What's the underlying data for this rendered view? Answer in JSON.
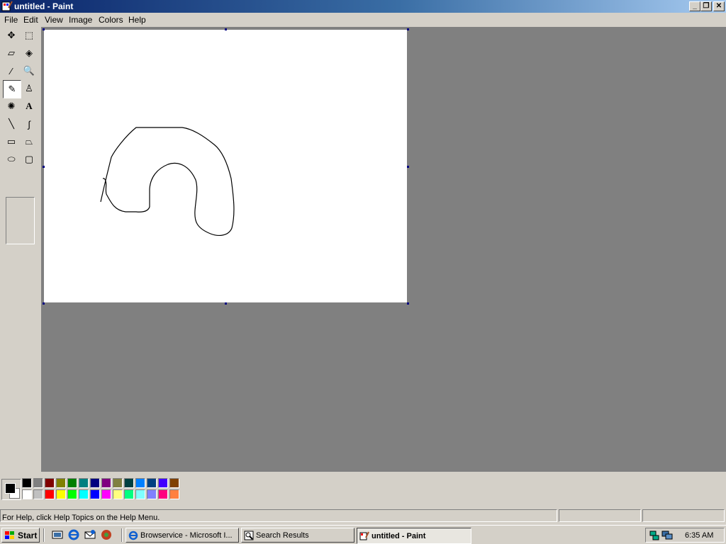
{
  "window": {
    "title": "untitled - Paint"
  },
  "menu": {
    "items": [
      "File",
      "Edit",
      "View",
      "Image",
      "Colors",
      "Help"
    ]
  },
  "tools": {
    "items": [
      {
        "name": "free-form-select",
        "glyph": "✥"
      },
      {
        "name": "select",
        "glyph": "⬚"
      },
      {
        "name": "eraser",
        "glyph": "▱"
      },
      {
        "name": "fill-with-color",
        "glyph": "◈"
      },
      {
        "name": "pick-color",
        "glyph": "⁄"
      },
      {
        "name": "magnifier",
        "glyph": "🔍"
      },
      {
        "name": "pencil",
        "glyph": "✎"
      },
      {
        "name": "brush",
        "glyph": "♙"
      },
      {
        "name": "airbrush",
        "glyph": "✺"
      },
      {
        "name": "text",
        "glyph": "A"
      },
      {
        "name": "line",
        "glyph": "╲"
      },
      {
        "name": "curve",
        "glyph": "∫"
      },
      {
        "name": "rectangle",
        "glyph": "▭"
      },
      {
        "name": "polygon",
        "glyph": "⏢"
      },
      {
        "name": "ellipse",
        "glyph": "⬭"
      },
      {
        "name": "rounded-rectangle",
        "glyph": "▢"
      }
    ],
    "selected": "pencil"
  },
  "palette": {
    "foreground": "#000000",
    "background": "#ffffff",
    "top_row": [
      "#000000",
      "#808080",
      "#800000",
      "#808000",
      "#008000",
      "#008080",
      "#000080",
      "#800080",
      "#808040",
      "#004040",
      "#0080ff",
      "#004080",
      "#4000ff",
      "#804000"
    ],
    "bottom_row": [
      "#ffffff",
      "#c0c0c0",
      "#ff0000",
      "#ffff00",
      "#00ff00",
      "#00ffff",
      "#0000ff",
      "#ff00ff",
      "#ffff80",
      "#00ff80",
      "#80ffff",
      "#8080ff",
      "#ff0080",
      "#ff8040"
    ]
  },
  "status": {
    "help_text": "For Help, click Help Topics on the Help Menu."
  },
  "taskbar": {
    "start_label": "Start",
    "tasks": [
      {
        "label": "Browservice - Microsoft I...",
        "active": false
      },
      {
        "label": "Search Results",
        "active": false
      },
      {
        "label": "untitled - Paint",
        "active": true
      }
    ],
    "clock": "6:35 AM"
  }
}
